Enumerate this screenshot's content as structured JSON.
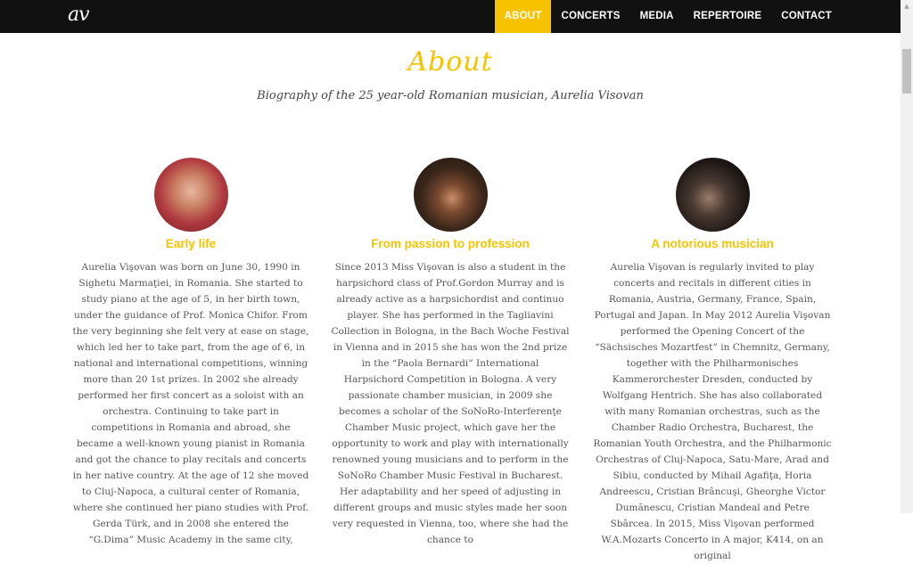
{
  "nav": {
    "logo": "av",
    "items": [
      {
        "label": "ABOUT",
        "active": true
      },
      {
        "label": "CONCERTS"
      },
      {
        "label": "MEDIA"
      },
      {
        "label": "REPERTOIRE"
      },
      {
        "label": "CONTACT"
      }
    ]
  },
  "header": {
    "title": "About",
    "subtitle": "Biography of the 25 year-old Romanian musician, Aurelia Visovan"
  },
  "columns": [
    {
      "heading": "Early life",
      "text": "Aurelia Vişovan was born on June 30, 1990 in Sighetu Marmaţiei, in Romania. She started to study piano at the age of 5, in her birth town, under the guidance of Prof. Monica Chifor. From the very beginning she felt very at ease on stage, which led her to take part, from the age of 6, in national and international competitions, winning more than 20 1st prizes. In 2002 she already performed her first concert as a soloist with an orchestra. Continuing to take part in competitions in Romania and abroad, she became a well-known young pianist in Romania and got the chance to play recitals and concerts in her native country. At the age of 12 she moved to Cluj-Napoca, a cultural center of Romania, where she continued her piano studies with Prof. Gerda Türk, and in 2008 she entered the “G.Dima” Music Academy in the same city,"
    },
    {
      "heading": "From passion to profession",
      "text": "Since 2013 Miss Vişovan is also a student in the harpsichord class of Prof.Gordon Murray and is already active as a harpsichordist and continuo player. She has performed in the Tagliavini Collection in Bologna, in the Bach Woche Festival in Vienna and in 2015 she has won the 2nd prize in the “Paola Bernardi” International Harpsichord Competition in Bologna. A very passionate chamber musician, in 2009 she becomes a scholar of the SoNoRo-Interferenţe Chamber Music project, which gave her the opportunity to work and play with internationally renowned young musicians and to perform in the SoNoRo Chamber Music Festival in Bucharest. Her adaptability and her speed of adjusting in different groups and music styles made her soon very requested in Vienna, too, where she had the chance to"
    },
    {
      "heading": "A notorious musician",
      "text": "Aurelia Vişovan is regularly invited to play concerts and recitals in different cities in Romania, Austria, Germany, France, Spain, Portugal and Japan. In May 2012 Aurelia Vişovan performed the Opening Concert of the “Sächsisches Mozartfest” in Chemnitz, Germany, together with the Philharmonisches Kammerorchester Dresden, conducted by Wolfgang Hentrich. She has also collaborated with many Romanian orchestras, such as the Chamber Radio Orchestra, Bucharest, the Romanian Youth Orchestra, and the Philharmonic Orchestras of Cluj-Napoca, Satu-Mare, Arad and Sibiu, conducted by Mihail Agafiţa, Horia Andreescu, Cristian Brâncuşi, Gheorghe Victor Dumănescu, Cristian Mandeal and Petre Sbârcea. In 2015, Miss Vişovan performed W.A.Mozarts Concerto in A major, K414, on an original"
    }
  ],
  "colors": {
    "accent": "#f7c300",
    "navbar": "#111111",
    "body_text": "#555555"
  }
}
